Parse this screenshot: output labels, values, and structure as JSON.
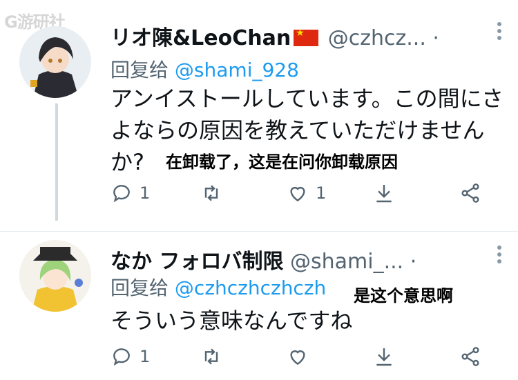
{
  "watermark": "G游研社",
  "tweets": [
    {
      "display_name": "リオ陳&LeoChan",
      "handle": "@czhcz...",
      "reply_label": "回复给",
      "reply_to": "@shami_928",
      "text": "アンイストールしています。この間にさよならの原因を教えていただけませんか?",
      "caption": "在卸载了，这是在问你卸载原因",
      "counts": {
        "reply": "1",
        "retweet": "",
        "like": "1"
      }
    },
    {
      "display_name": "なか フォロバ制限",
      "handle": "@shami_...",
      "reply_label": "回复给",
      "reply_to": "@czhczhczhczh",
      "text": "そういう意味なんですね",
      "caption": "是这个意思啊",
      "counts": {
        "reply": "1",
        "retweet": "",
        "like": ""
      }
    }
  ],
  "icons": [
    "reply-icon",
    "retweet-icon",
    "like-icon",
    "download-icon",
    "share-icon",
    "more-icon"
  ],
  "colors": {
    "flag_red": "#de2910",
    "mention_blue": "#1d9bf0",
    "secondary": "#536471"
  }
}
